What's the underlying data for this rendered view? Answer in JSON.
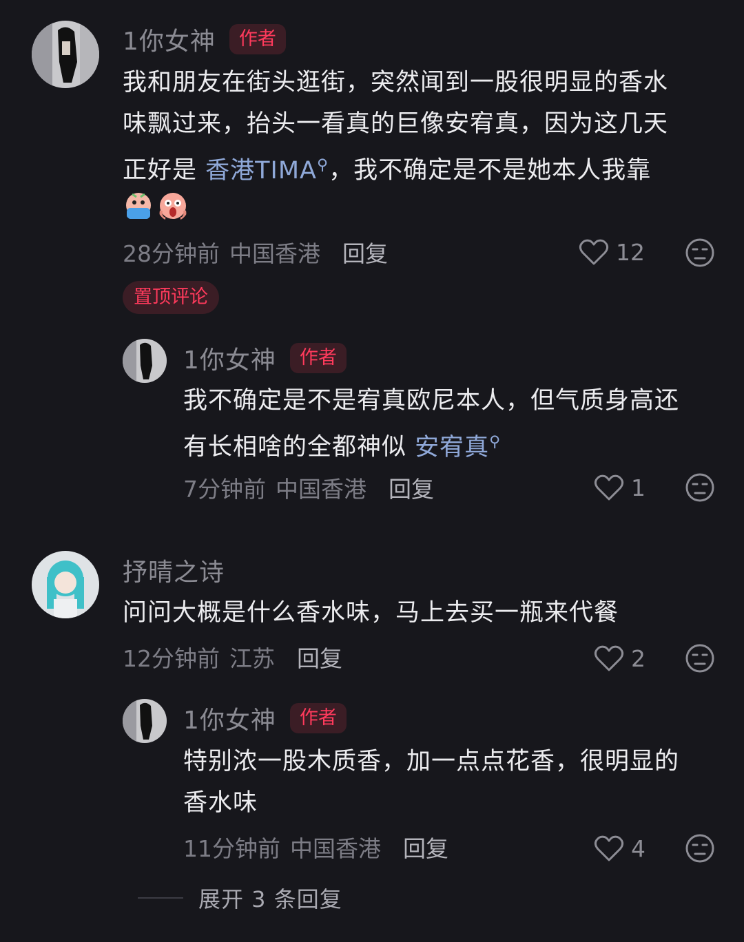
{
  "comments": [
    {
      "username": "1你女神",
      "badge": "作者",
      "text_parts": [
        "我和朋友在街头逛街，突然闻到一股很明显的香水",
        "味飘过来，抬头一看真的巨像安宥真，因为这几天",
        "正好是 ",
        "香港TIMA",
        "，我不确定是不是她本人我靠"
      ],
      "emoji_icons": [
        "crying-face-emoji",
        "screaming-face-emoji"
      ],
      "time": "28分钟前",
      "location": "中国香港",
      "reply_label": "回复",
      "likes": "12",
      "pinned_label": "置顶评论",
      "replies": [
        {
          "username": "1你女神",
          "badge": "作者",
          "text_parts": [
            "我不确定是不是宥真欧尼本人，但气质身高还",
            "有长相啥的全都神似 ",
            "安宥真"
          ],
          "time": "7分钟前",
          "location": "中国香港",
          "reply_label": "回复",
          "likes": "1"
        }
      ]
    },
    {
      "username": "抒晴之诗",
      "text": "问问大概是什么香水味，马上去买一瓶来代餐",
      "time": "12分钟前",
      "location": "江苏",
      "reply_label": "回复",
      "likes": "2",
      "replies": [
        {
          "username": "1你女神",
          "badge": "作者",
          "text_lines": [
            "特别浓一股木质香，加一点点花香，很明显的",
            "香水味"
          ],
          "time": "11分钟前",
          "location": "中国香港",
          "reply_label": "回复",
          "likes": "4"
        }
      ],
      "expand_label": "展开 3 条回复"
    }
  ],
  "colors": {
    "background": "#17171c",
    "accent_red": "#ff3a5c",
    "link_blue": "#8fa8d8"
  }
}
